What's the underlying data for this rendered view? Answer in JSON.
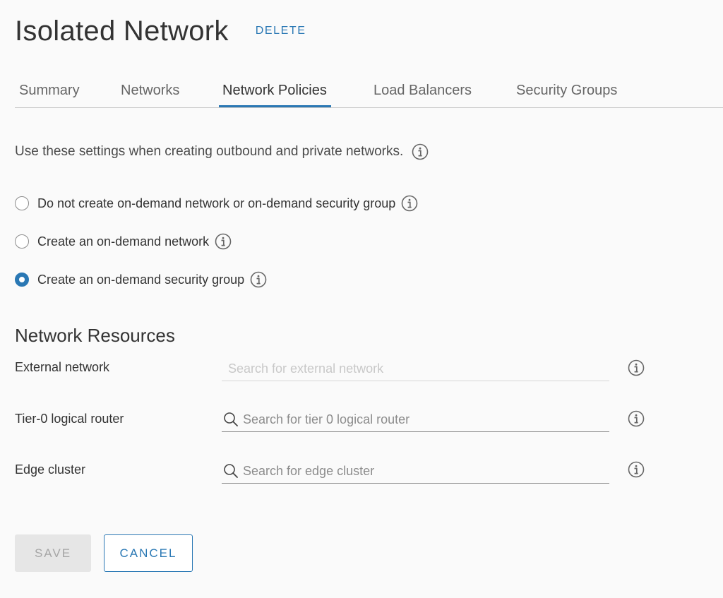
{
  "header": {
    "title": "Isolated Network",
    "delete_label": "DELETE"
  },
  "tabs": [
    {
      "label": "Summary",
      "active": false
    },
    {
      "label": "Networks",
      "active": false
    },
    {
      "label": "Network Policies",
      "active": true
    },
    {
      "label": "Load Balancers",
      "active": false
    },
    {
      "label": "Security Groups",
      "active": false
    }
  ],
  "policies": {
    "intro": "Use these settings when creating outbound and private networks.",
    "options": [
      {
        "label": "Do not create on-demand network or on-demand security group",
        "checked": false
      },
      {
        "label": "Create an on-demand network",
        "checked": false
      },
      {
        "label": "Create an on-demand security group",
        "checked": true
      }
    ]
  },
  "resources": {
    "title": "Network Resources",
    "fields": [
      {
        "label": "External network",
        "placeholder": "Search for external network",
        "value": "",
        "disabled": true,
        "search_icon": false
      },
      {
        "label": "Tier-0 logical router",
        "placeholder": "Search for tier 0 logical router",
        "value": "",
        "disabled": false,
        "search_icon": true
      },
      {
        "label": "Edge cluster",
        "placeholder": "Search for edge cluster",
        "value": "",
        "disabled": false,
        "search_icon": true
      }
    ]
  },
  "actions": {
    "save_label": "SAVE",
    "save_disabled": true,
    "cancel_label": "CANCEL"
  },
  "colors": {
    "accent": "#2a78b4",
    "text": "#333333",
    "disabled_bg": "#e6e6e6",
    "disabled_text": "#a6a6a6"
  },
  "icons": {
    "info": "info-circle-icon",
    "search": "search-icon"
  }
}
